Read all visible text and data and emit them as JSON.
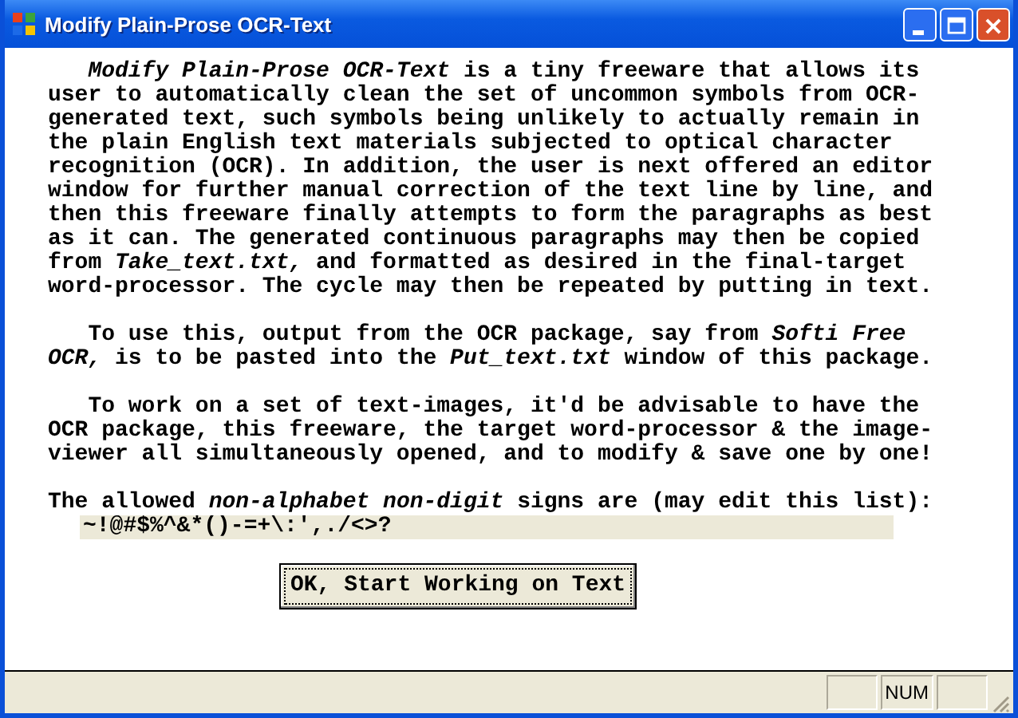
{
  "window": {
    "title": "Modify Plain-Prose OCR-Text"
  },
  "paragraphs": [
    {
      "lines": [
        "*Modify Plain-Prose OCR-Text*  is a tiny freeware that allows its",
        "user to automatically clean the set of uncommon symbols from OCR-",
        "generated text, such symbols being unlikely to actually remain in",
        "the plain English text materials subjected to optical character",
        "recognition (OCR). In addition, the user is next offered an editor",
        "window for further manual correction of the text line by line, and",
        "then this freeware finally attempts to form the paragraphs as best",
        "as it can. The generated continuous paragraphs may then be copied",
        "from *Take_text.txt,*  and formatted as desired in the final-target",
        "word-processor. The cycle may then be repeated by putting in text."
      ]
    },
    {
      "lines": [
        "To use this, output from the OCR package, say from *Softi Free*",
        "*OCR,* is to be pasted into the *Put_text.txt* window of this package."
      ]
    },
    {
      "lines": [
        "To work on a set of text-images, it'd be advisable to have the",
        "OCR package, this freeware, the target word-processor & the image-",
        "viewer all simultaneously opened, and to modify & save one by one!"
      ]
    }
  ],
  "allowed_label": "The allowed *non-alphabet non-digit* signs are (may edit this list):",
  "allowed_signs": {
    "value": "~!@#$%^&*()-=+\\:',./<>?"
  },
  "button": "OK, Start Working on Text",
  "status_bar": {
    "indicator": "NUM"
  }
}
